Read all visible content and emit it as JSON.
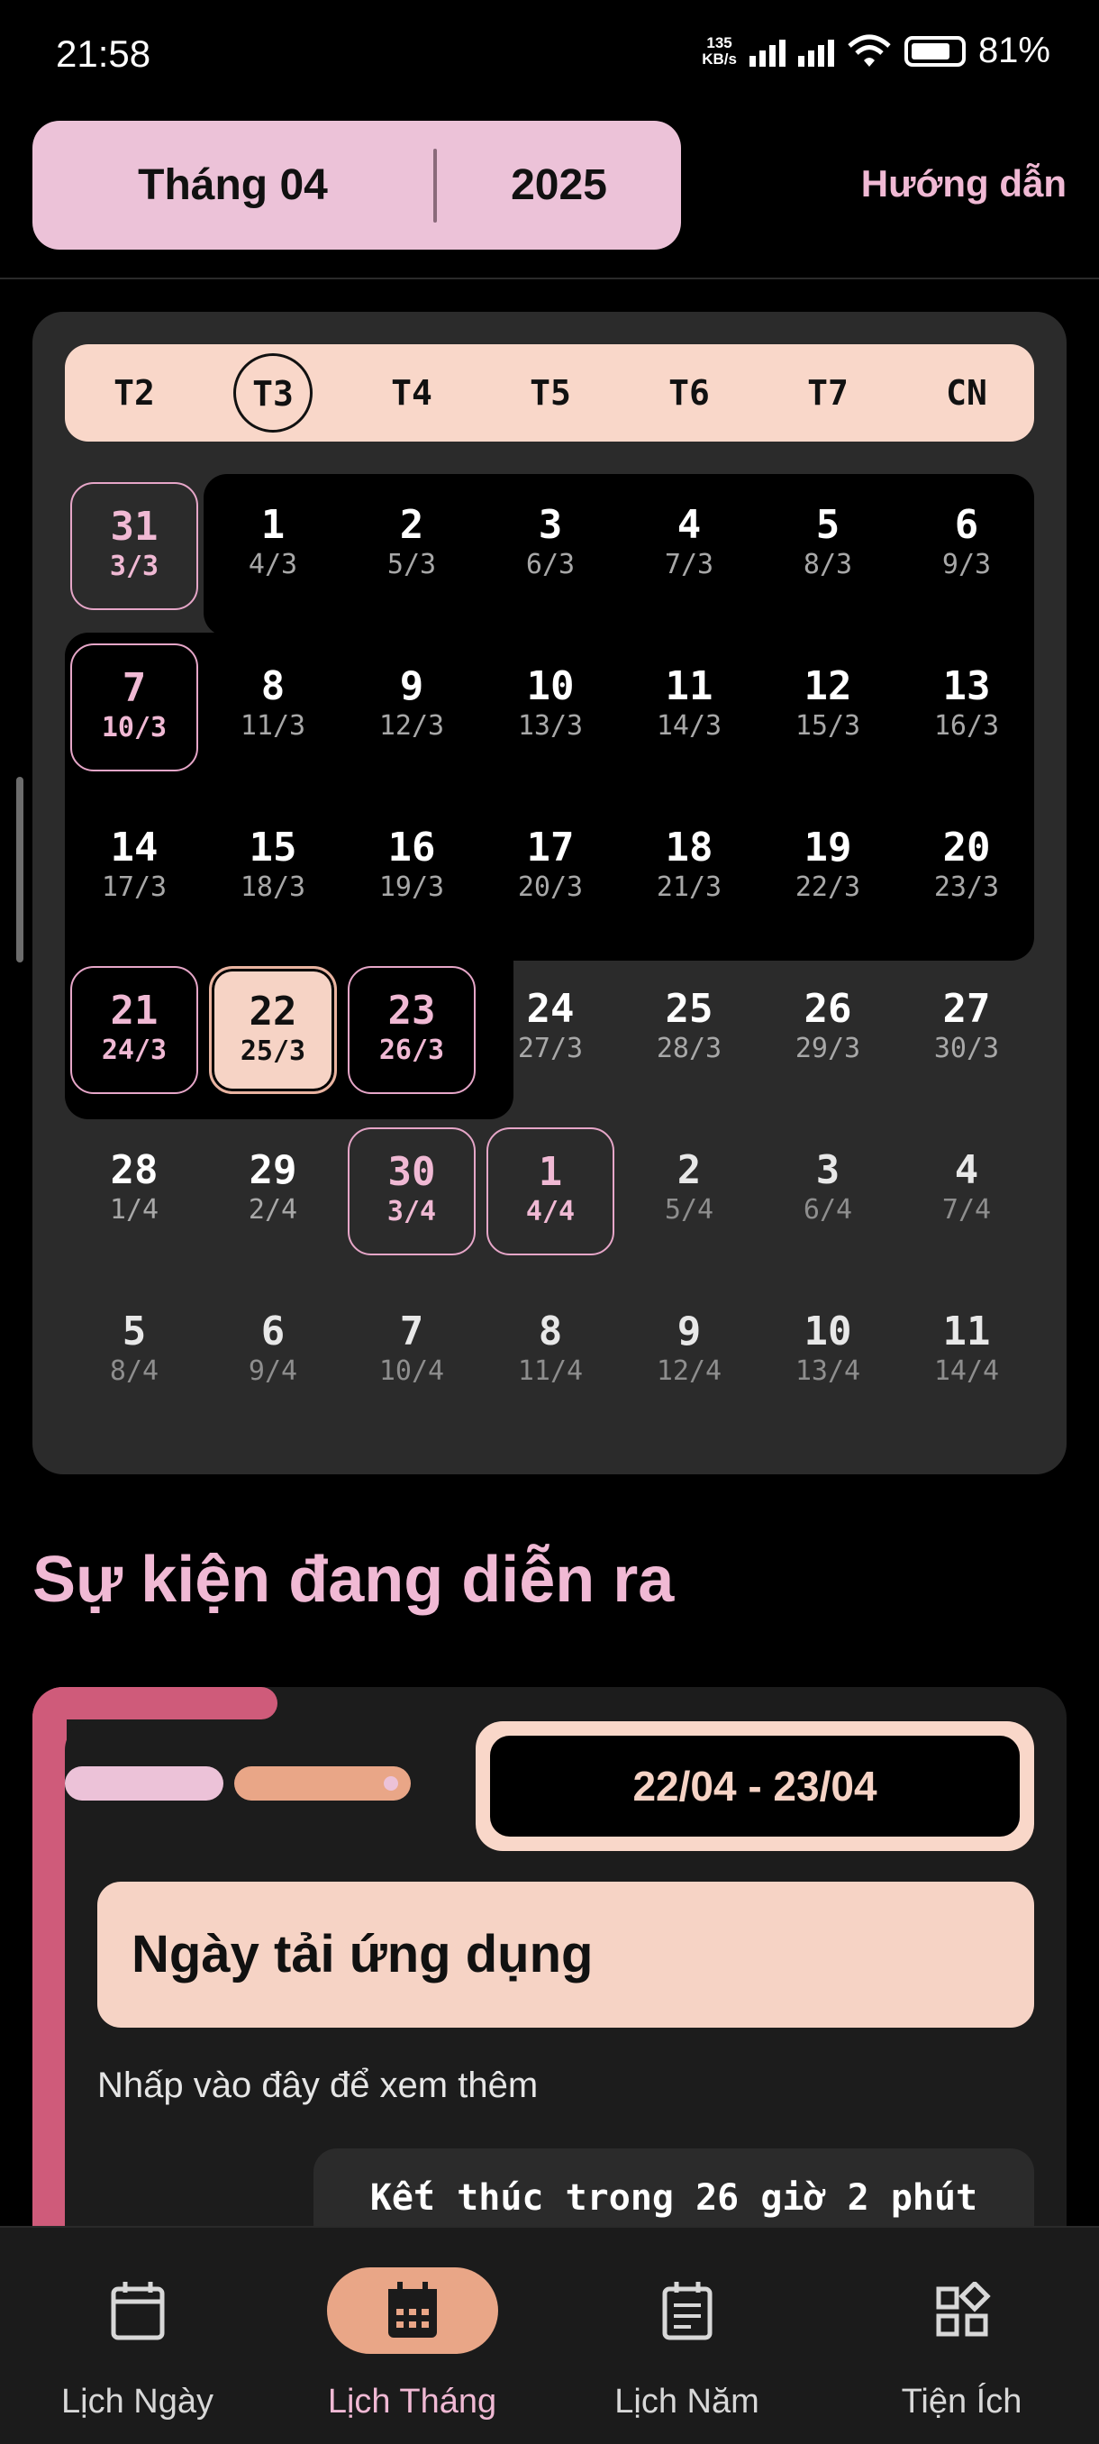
{
  "status_bar": {
    "time": "21:58",
    "net_speed": "135",
    "net_unit": "KB/s",
    "battery": "81%"
  },
  "header": {
    "month": "Tháng 04",
    "year": "2025",
    "guide": "Hướng dẫn"
  },
  "calendar": {
    "weekdays": [
      "T2",
      "T3",
      "T4",
      "T5",
      "T6",
      "T7",
      "CN"
    ],
    "today_weekday": "T3",
    "weeks": [
      [
        {
          "d": "31",
          "l": "3/3",
          "t": "hl"
        },
        {
          "d": "1",
          "l": "4/3",
          "t": "cur"
        },
        {
          "d": "2",
          "l": "5/3",
          "t": "cur"
        },
        {
          "d": "3",
          "l": "6/3",
          "t": "cur"
        },
        {
          "d": "4",
          "l": "7/3",
          "t": "cur"
        },
        {
          "d": "5",
          "l": "8/3",
          "t": "cur"
        },
        {
          "d": "6",
          "l": "9/3",
          "t": "cur"
        }
      ],
      [
        {
          "d": "7",
          "l": "10/3",
          "t": "hl"
        },
        {
          "d": "8",
          "l": "11/3",
          "t": "cur"
        },
        {
          "d": "9",
          "l": "12/3",
          "t": "cur"
        },
        {
          "d": "10",
          "l": "13/3",
          "t": "cur"
        },
        {
          "d": "11",
          "l": "14/3",
          "t": "cur"
        },
        {
          "d": "12",
          "l": "15/3",
          "t": "cur"
        },
        {
          "d": "13",
          "l": "16/3",
          "t": "cur"
        }
      ],
      [
        {
          "d": "14",
          "l": "17/3",
          "t": "cur"
        },
        {
          "d": "15",
          "l": "18/3",
          "t": "cur"
        },
        {
          "d": "16",
          "l": "19/3",
          "t": "cur"
        },
        {
          "d": "17",
          "l": "20/3",
          "t": "cur"
        },
        {
          "d": "18",
          "l": "21/3",
          "t": "cur"
        },
        {
          "d": "19",
          "l": "22/3",
          "t": "cur"
        },
        {
          "d": "20",
          "l": "23/3",
          "t": "cur"
        }
      ],
      [
        {
          "d": "21",
          "l": "24/3",
          "t": "hl"
        },
        {
          "d": "22",
          "l": "25/3",
          "t": "sel"
        },
        {
          "d": "23",
          "l": "26/3",
          "t": "hl"
        },
        {
          "d": "24",
          "l": "27/3",
          "t": "cur"
        },
        {
          "d": "25",
          "l": "28/3",
          "t": "cur"
        },
        {
          "d": "26",
          "l": "29/3",
          "t": "cur"
        },
        {
          "d": "27",
          "l": "30/3",
          "t": "cur"
        }
      ],
      [
        {
          "d": "28",
          "l": "1/4",
          "t": "cur"
        },
        {
          "d": "29",
          "l": "2/4",
          "t": "cur"
        },
        {
          "d": "30",
          "l": "3/4",
          "t": "hl"
        },
        {
          "d": "1",
          "l": "4/4",
          "t": "pm"
        },
        {
          "d": "2",
          "l": "5/4",
          "t": "oth"
        },
        {
          "d": "3",
          "l": "6/4",
          "t": "oth"
        },
        {
          "d": "4",
          "l": "7/4",
          "t": "oth"
        }
      ],
      [
        {
          "d": "5",
          "l": "8/4",
          "t": "oth"
        },
        {
          "d": "6",
          "l": "9/4",
          "t": "oth"
        },
        {
          "d": "7",
          "l": "10/4",
          "t": "oth"
        },
        {
          "d": "8",
          "l": "11/4",
          "t": "oth"
        },
        {
          "d": "9",
          "l": "12/4",
          "t": "oth"
        },
        {
          "d": "10",
          "l": "13/4",
          "t": "oth"
        },
        {
          "d": "11",
          "l": "14/4",
          "t": "oth"
        }
      ]
    ]
  },
  "events": {
    "title": "Sự kiện đang diễn ra",
    "items": [
      {
        "date_range": "22/04 - 23/04",
        "name": "Ngày tải ứng dụng",
        "description": "Nhấp vào đây để xem thêm",
        "remaining": "Kết thúc trong 26 giờ 2 phút"
      }
    ]
  },
  "nav": {
    "items": [
      {
        "label": "Lịch Ngày",
        "icon": "calendar-day-icon",
        "active": false
      },
      {
        "label": "Lịch Tháng",
        "icon": "calendar-month-icon",
        "active": true
      },
      {
        "label": "Lịch Năm",
        "icon": "calendar-year-icon",
        "active": false
      },
      {
        "label": "Tiện Ích",
        "icon": "widgets-icon",
        "active": false
      }
    ]
  },
  "colors": {
    "pink": "#ecc2d8",
    "peach": "#f6d3c5",
    "orange": "#e9a687",
    "rose": "#cf5b7a",
    "card": "#2b2b2b"
  }
}
